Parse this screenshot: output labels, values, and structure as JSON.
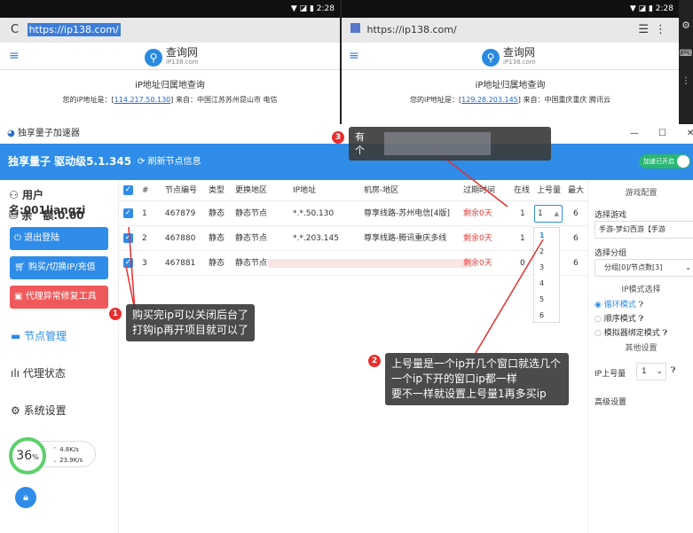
{
  "phone": {
    "left": {
      "time": "2:28",
      "url": "https://ip138.com/",
      "logo": "查询网",
      "logo_sub": "iP138.com",
      "page_title": "iP地址归属地查询",
      "ip_prefix": "您的iP地址是：[",
      "ip": "114.217.50.130",
      "ip_suffix": "] 来自：中国江苏苏州昆山市 电信"
    },
    "right": {
      "time": "2:28",
      "url": "https://ip138.com/",
      "logo": "查询网",
      "logo_sub": "iP138.com",
      "page_title": "iP地址归属地查询",
      "ip_prefix": "您的iP地址是：[",
      "ip": "129.28.203.145",
      "ip_suffix": "] 来自：中国重庆重庆 腾讯云"
    }
  },
  "app": {
    "title": "独享量子加速器",
    "window_controls": {
      "minimize": "—",
      "maximize": "☐",
      "close": "✕"
    },
    "header_title": "独享量子 驱动级5.1.345",
    "refresh_label": "刷新节点信息",
    "toggle_label": "加速已开启"
  },
  "sidebar": {
    "user_label": "用户名:001liangzi",
    "balance_label": "余　额:0.00",
    "logout": "退出登陆",
    "buy": "购买/切换IP/充值",
    "repair": "代理异常修复工具",
    "nav": [
      "节点管理",
      "代理状态",
      "系统设置"
    ],
    "speed": {
      "percent": "36",
      "percent_unit": "%",
      "up": "4.8K/s",
      "down": "23.9K/s"
    }
  },
  "table": {
    "headers": [
      "#",
      "节点编号",
      "类型",
      "更换地区",
      "IP地址",
      "机房-地区",
      "过期时间",
      "在线",
      "上号量",
      "最大"
    ],
    "rows": [
      {
        "idx": "1",
        "id": "467879",
        "type": "静态",
        "region": "静态节点",
        "ip": "*.*.50.130",
        "room": "尊享线路-苏州电信[4版]",
        "expire": "剩余0天",
        "online": "1",
        "qty": "1",
        "max": "6"
      },
      {
        "idx": "2",
        "id": "467880",
        "type": "静态",
        "region": "静态节点",
        "ip": "*.*.203.145",
        "room": "尊享线路-腾讯重庆多线",
        "expire": "剩余0天",
        "online": "1",
        "qty": "",
        "max": "6"
      },
      {
        "idx": "3",
        "id": "467881",
        "type": "静态",
        "region": "静态节点",
        "ip": "",
        "room": "",
        "expire": "剩余0天",
        "online": "0",
        "qty": "",
        "max": "6"
      }
    ],
    "dropdown_options": [
      "1",
      "2",
      "3",
      "4",
      "5",
      "6"
    ]
  },
  "right_panel": {
    "game_config": "游戏配置",
    "choose_game": "选择游戏",
    "game_value": "手游-梦幻西游【手游",
    "choose_group": "选择分组",
    "group_value": "分组[0]/节点数[3]",
    "ip_mode_title": "IP模式选择",
    "modes": [
      "循环模式",
      "顺序模式",
      "模拟器绑定模式"
    ],
    "other_title": "其他设置",
    "ip_qty_label": "IP上号量",
    "ip_qty_value": "1",
    "advanced": "高级设置"
  },
  "annotations": [
    {
      "num": "1",
      "lines": [
        "购买完ip可以关闭后台了",
        "打钩ip再开项目就可以了"
      ]
    },
    {
      "num": "2",
      "lines": [
        "上号量是一个ip开几个窗口就选几个",
        "一个ip下开的窗口ip都一样",
        "要不一样就设置上号量1再多买ip"
      ]
    },
    {
      "num": "3",
      "lines": [
        "有",
        "个"
      ]
    }
  ]
}
